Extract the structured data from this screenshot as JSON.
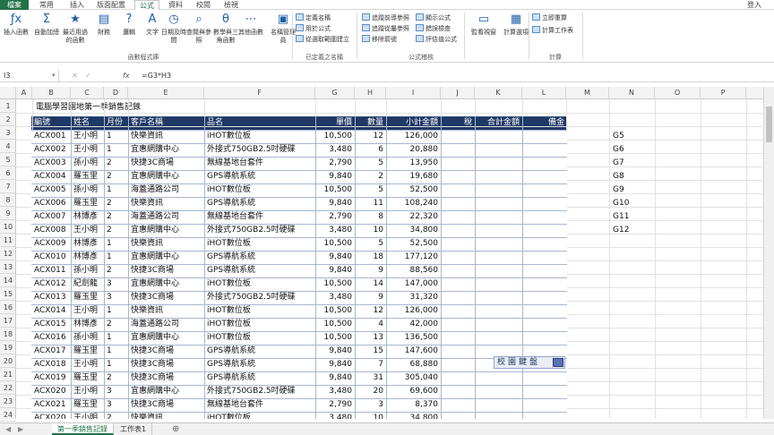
{
  "tabs": [
    "檔案",
    "常用",
    "插入",
    "版面配置",
    "公式",
    "資料",
    "校閱",
    "檢視"
  ],
  "login": "登入",
  "ribbon": {
    "buttons": [
      {
        "label": "插入函數",
        "icon": "fx-icon"
      },
      {
        "label": "自動加總",
        "icon": "sigma-icon"
      },
      {
        "label": "最近用過的函數",
        "icon": "star-icon"
      },
      {
        "label": "財務",
        "icon": "book-icon"
      },
      {
        "label": "邏輯",
        "icon": "question-icon"
      },
      {
        "label": "文字",
        "icon": "text-icon"
      },
      {
        "label": "日期及時間",
        "icon": "clock-icon"
      },
      {
        "label": "查閱與參照",
        "icon": "search-icon"
      },
      {
        "label": "數學與三角函數",
        "icon": "theta-icon"
      },
      {
        "label": "其他函數",
        "icon": "more-icon"
      },
      {
        "label": "名稱管理員",
        "icon": "tag-icon"
      }
    ],
    "names_small": [
      "定義名稱",
      "用於公式",
      "從選取範圍建立"
    ],
    "audit_small": [
      "追蹤前導參照",
      "追蹤從屬參照",
      "移除箭號",
      "顯示公式",
      "錯誤檢查",
      "評估值公式"
    ],
    "watch": "監看視窗",
    "calc_options": "計算選項",
    "calc_small": [
      "立即重算",
      "計算工作表"
    ],
    "group_labels": [
      "函數程式庫",
      "已定義之名稱",
      "公式稽核",
      "計算"
    ]
  },
  "formula_bar": {
    "name_box": "I3",
    "fx": "fx",
    "formula": "=G3*H3"
  },
  "columns": [
    "A",
    "B",
    "C",
    "D",
    "E",
    "F",
    "G",
    "H",
    "I",
    "J",
    "K",
    "L",
    "M",
    "N",
    "O",
    "P"
  ],
  "rows": [
    "1",
    "2",
    "3",
    "4",
    "5",
    "6",
    "7",
    "8",
    "9",
    "10",
    "11",
    "12",
    "13",
    "14",
    "15",
    "16",
    "17",
    "18",
    "19",
    "20",
    "21",
    "22",
    "23",
    "24"
  ],
  "sheet_title": "電腦學習園地第一季銷售記錄",
  "headers": [
    "編號",
    "姓名",
    "月份",
    "客戶名稱",
    "品名",
    "單價",
    "數量",
    "小計金額",
    "稅",
    "合計金額",
    "備金"
  ],
  "table_rows": [
    [
      "ACX001",
      "王小明",
      "1",
      "快樂資訊",
      "iHOT數位板",
      "10,500",
      "12",
      "126,000"
    ],
    [
      "ACX002",
      "王小明",
      "1",
      "宜惠網購中心",
      "外接式750GB2.5吋硬碟",
      "3,480",
      "6",
      "20,880"
    ],
    [
      "ACX003",
      "孫小明",
      "2",
      "快捷3C商場",
      "無線基地台套件",
      "2,790",
      "5",
      "13,950"
    ],
    [
      "ACX004",
      "羅玉里",
      "2",
      "宜惠網購中心",
      "GPS導航系統",
      "9,840",
      "2",
      "19,680"
    ],
    [
      "ACX005",
      "孫小明",
      "1",
      "海蓋通路公司",
      "iHOT數位板",
      "10,500",
      "5",
      "52,500"
    ],
    [
      "ACX006",
      "羅玉里",
      "2",
      "快樂資訊",
      "GPS導航系統",
      "9,840",
      "11",
      "108,240"
    ],
    [
      "ACX007",
      "林博彥",
      "2",
      "海蓋通路公司",
      "無線基地台套件",
      "2,790",
      "8",
      "22,320"
    ],
    [
      "ACX008",
      "王小明",
      "2",
      "宜惠網購中心",
      "外接式750GB2.5吋硬碟",
      "3,480",
      "10",
      "34,800"
    ],
    [
      "ACX009",
      "林博彥",
      "1",
      "快樂資訊",
      "iHOT數位板",
      "10,500",
      "5",
      "52,500"
    ],
    [
      "ACX010",
      "林博彥",
      "1",
      "宜惠網購中心",
      "GPS導航系統",
      "9,840",
      "18",
      "177,120"
    ],
    [
      "ACX011",
      "孫小明",
      "2",
      "快捷3C商場",
      "GPS導航系統",
      "9,840",
      "9",
      "88,560"
    ],
    [
      "ACX012",
      "紀劍龍",
      "3",
      "宜惠網購中心",
      "iHOT數位板",
      "10,500",
      "14",
      "147,000"
    ],
    [
      "ACX013",
      "羅玉里",
      "3",
      "快捷3C商場",
      "外接式750GB2.5吋硬碟",
      "3,480",
      "9",
      "31,320"
    ],
    [
      "ACX014",
      "王小明",
      "1",
      "快樂資訊",
      "iHOT數位板",
      "10,500",
      "12",
      "126,000"
    ],
    [
      "ACX015",
      "林博彥",
      "2",
      "海蓋通路公司",
      "iHOT數位板",
      "10,500",
      "4",
      "42,000"
    ],
    [
      "ACX016",
      "孫小明",
      "1",
      "宜惠網購中心",
      "iHOT數位板",
      "10,500",
      "13",
      "136,500"
    ],
    [
      "ACX017",
      "羅玉里",
      "1",
      "快捷3C商場",
      "GPS導航系統",
      "9,840",
      "15",
      "147,600"
    ],
    [
      "ACX018",
      "王小明",
      "1",
      "快捷3C商場",
      "GPS導航系統",
      "9,840",
      "7",
      "68,880"
    ],
    [
      "ACX019",
      "羅玉里",
      "2",
      "快捷3C商場",
      "GPS導航系統",
      "9,840",
      "31",
      "305,040"
    ],
    [
      "ACX020",
      "王小明",
      "3",
      "宜惠網購中心",
      "外接式750GB2.5吋硬碟",
      "3,480",
      "20",
      "69,600"
    ],
    [
      "ACX021",
      "羅玉里",
      "3",
      "快捷3C商場",
      "無線基地台套件",
      "2,790",
      "3",
      "8,370"
    ],
    [
      "ACX020",
      "王小明",
      "2",
      "快樂資訊",
      "iHOT數位板",
      "3,480",
      "10",
      "34,800"
    ]
  ],
  "n_refs": [
    "G5",
    "G6",
    "G7",
    "G8",
    "G9",
    "G10",
    "G11",
    "G12"
  ],
  "ime_bar": "校園鍵盤",
  "sheet_tabs": [
    "第一季銷售記錄",
    "工作表1"
  ],
  "add_sheet": "⊕"
}
